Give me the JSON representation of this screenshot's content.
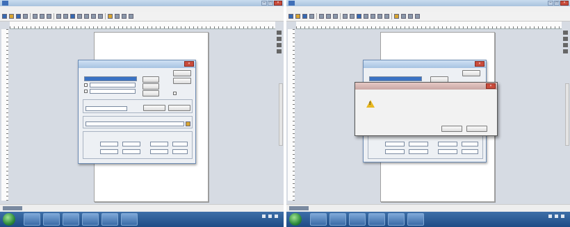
{
  "screens": [
    {
      "id": "left",
      "app": {
        "title": "",
        "menu": [
          "",
          "",
          "",
          "",
          "",
          "",
          "",
          ""
        ]
      },
      "dialog": {
        "title": "",
        "buttons": [
          "",
          "",
          "",
          "",
          "",
          "",
          ""
        ],
        "fields": [
          "",
          "",
          "",
          "",
          "",
          ""
        ]
      },
      "taskbar": {
        "clock": ""
      }
    },
    {
      "id": "right",
      "app": {
        "title": "",
        "menu": [
          "",
          "",
          "",
          "",
          "",
          "",
          "",
          ""
        ]
      },
      "dialog": {
        "title": ""
      },
      "alert": {
        "title": "",
        "message": "",
        "ok_label": "",
        "cancel_label": ""
      },
      "taskbar": {
        "clock": ""
      }
    }
  ],
  "colors": {
    "desktop": "#d6dbe3",
    "taskbar": "#1e4c86",
    "accent": "#3a72c4",
    "close": "#c94c3c",
    "warning": "#e8b820"
  }
}
